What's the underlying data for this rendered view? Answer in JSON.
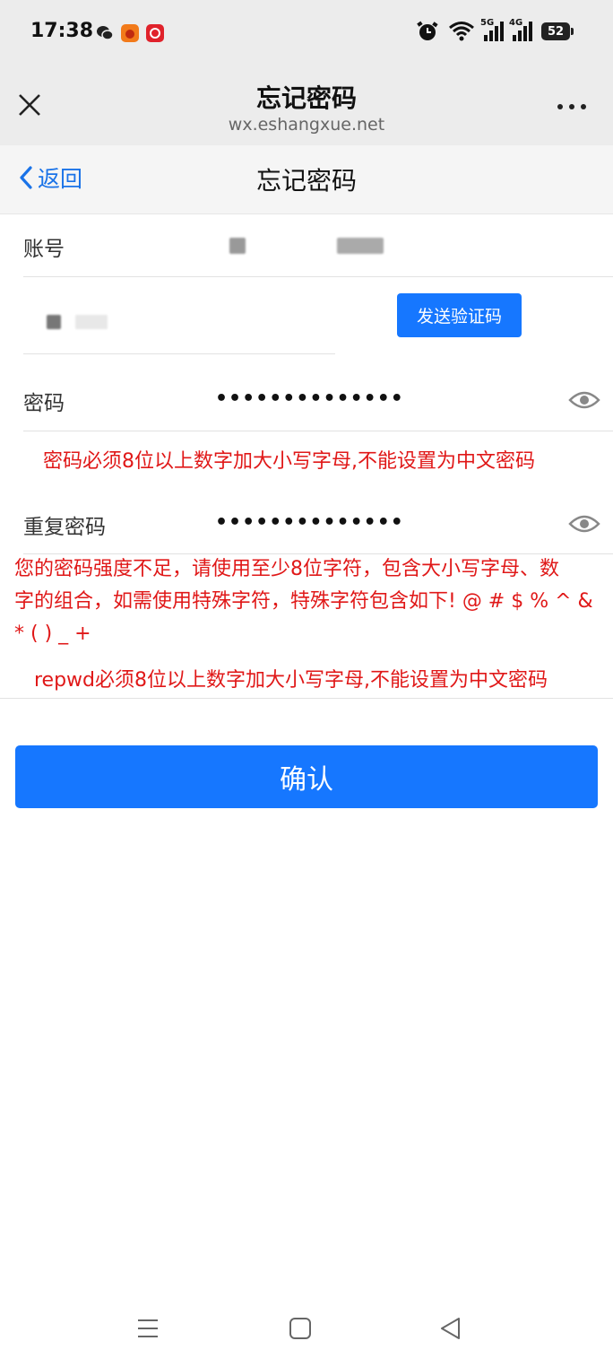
{
  "status_bar": {
    "time": "17:38",
    "battery": "52",
    "net1": "5G",
    "net2": "4G",
    "icons": [
      "wechat-icon",
      "app-icon-orange",
      "app-icon-red",
      "alarm-icon",
      "wifi-icon",
      "signal-5g-icon",
      "signal-4g-icon",
      "battery-icon"
    ]
  },
  "wechat_header": {
    "title": "忘记密码",
    "url": "wx.eshangxue.net"
  },
  "page_nav": {
    "back_label": "返回",
    "title": "忘记密码"
  },
  "form": {
    "account_label": "账号",
    "send_code_label": "发送验证码",
    "password_label": "密码",
    "password_value": "••••••••••••••",
    "password_error": "密码必须8位以上数字加大小写字母,不能设置为中文密码",
    "repeat_label": "重复密码",
    "repeat_value": "••••••••••••••",
    "strength_error_lines": [
      "您的密码强度不足，请使用至少8位字符，包含大小写字母、数",
      "字的组合，如需使用特殊字符，特殊字符包含如下! @ # $ % ^ &",
      "* ( ) _ +"
    ],
    "repwd_error": "repwd必须8位以上数字加大小写字母,不能设置为中文密码",
    "confirm_label": "确认"
  },
  "colors": {
    "accent": "#1677ff",
    "error": "#e01818",
    "link": "#1a73e8"
  }
}
